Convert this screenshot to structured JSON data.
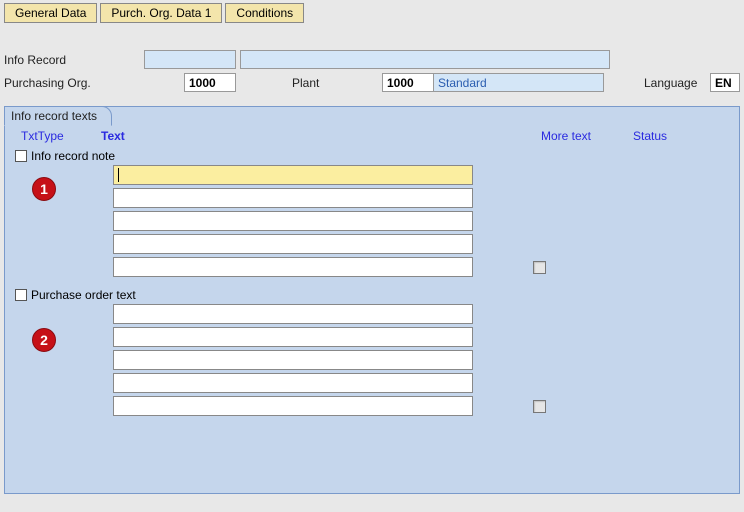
{
  "tabs": {
    "general": "General Data",
    "purchOrg": "Purch. Org. Data 1",
    "conditions": "Conditions"
  },
  "header": {
    "infoRecordLabel": "Info Record",
    "infoRecordValue": "",
    "infoRecordDesc": "",
    "purchOrgLabel": "Purchasing Org.",
    "purchOrgValue": "1000",
    "plantLabel": "Plant",
    "plantValue": "1000",
    "plantDesc": "Standard",
    "languageLabel": "Language",
    "languageValue": "EN"
  },
  "panel": {
    "tabLabel": "Info record texts",
    "cols": {
      "txtType": "TxtType",
      "text": "Text",
      "moreText": "More text",
      "status": "Status"
    },
    "sections": [
      {
        "label": "Info record note",
        "marker": "1",
        "lines": [
          "",
          "",
          "",
          "",
          ""
        ]
      },
      {
        "label": "Purchase order text",
        "marker": "2",
        "lines": [
          "",
          "",
          "",
          "",
          ""
        ]
      }
    ]
  }
}
